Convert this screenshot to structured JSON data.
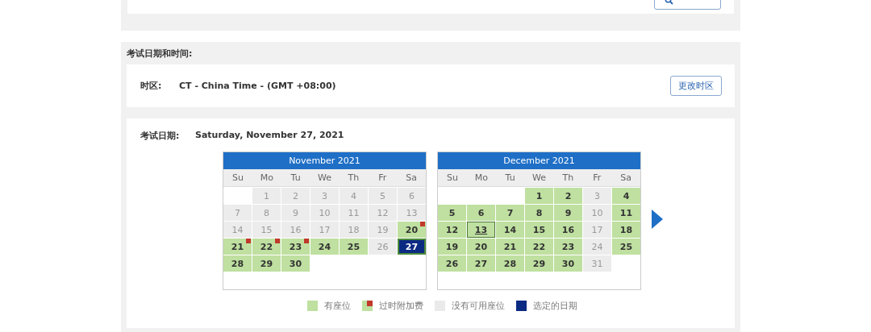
{
  "top_card": {
    "button": {
      "kind": "search"
    }
  },
  "section_title": "考试日期和时间:",
  "timezone": {
    "label": "时区:",
    "value": "CT - China Time - (GMT +08:00)",
    "button": "更改时区"
  },
  "exam_date": {
    "label": "考试日期:",
    "value": "Saturday, November 27, 2021"
  },
  "months": [
    {
      "title": "November 2021",
      "weekdays": [
        "Su",
        "Mo",
        "Tu",
        "We",
        "Th",
        "Fr",
        "Sa"
      ],
      "cells": [
        {
          "kind": "blank"
        },
        {
          "day": "1",
          "kind": "none",
          "selected": false,
          "outlined": false
        },
        {
          "day": "2",
          "kind": "none",
          "selected": false,
          "outlined": false
        },
        {
          "day": "3",
          "kind": "none",
          "selected": false,
          "outlined": false
        },
        {
          "day": "4",
          "kind": "none",
          "selected": false,
          "outlined": false
        },
        {
          "day": "5",
          "kind": "none",
          "selected": false,
          "outlined": false
        },
        {
          "day": "6",
          "kind": "none",
          "selected": false,
          "outlined": false
        },
        {
          "day": "7",
          "kind": "none",
          "selected": false,
          "outlined": false
        },
        {
          "day": "8",
          "kind": "none",
          "selected": false,
          "outlined": false
        },
        {
          "day": "9",
          "kind": "none",
          "selected": false,
          "outlined": false
        },
        {
          "day": "10",
          "kind": "none",
          "selected": false,
          "outlined": false
        },
        {
          "day": "11",
          "kind": "none",
          "selected": false,
          "outlined": false
        },
        {
          "day": "12",
          "kind": "none",
          "selected": false,
          "outlined": false
        },
        {
          "day": "13",
          "kind": "none",
          "selected": false,
          "outlined": false
        },
        {
          "day": "14",
          "kind": "none",
          "selected": false,
          "outlined": false
        },
        {
          "day": "15",
          "kind": "none",
          "selected": false,
          "outlined": false
        },
        {
          "day": "16",
          "kind": "none",
          "selected": false,
          "outlined": false
        },
        {
          "day": "17",
          "kind": "none",
          "selected": false,
          "outlined": false
        },
        {
          "day": "18",
          "kind": "none",
          "selected": false,
          "outlined": false
        },
        {
          "day": "19",
          "kind": "none",
          "selected": false,
          "outlined": false
        },
        {
          "day": "20",
          "kind": "late",
          "selected": false,
          "outlined": false
        },
        {
          "day": "21",
          "kind": "late",
          "selected": false,
          "outlined": false
        },
        {
          "day": "22",
          "kind": "late",
          "selected": false,
          "outlined": false
        },
        {
          "day": "23",
          "kind": "late",
          "selected": false,
          "outlined": false
        },
        {
          "day": "24",
          "kind": "seat",
          "selected": false,
          "outlined": false
        },
        {
          "day": "25",
          "kind": "seat",
          "selected": false,
          "outlined": false
        },
        {
          "day": "26",
          "kind": "none",
          "selected": false,
          "outlined": false
        },
        {
          "day": "27",
          "kind": "seat",
          "selected": true,
          "outlined": false
        },
        {
          "day": "28",
          "kind": "seat",
          "selected": false,
          "outlined": false
        },
        {
          "day": "29",
          "kind": "seat",
          "selected": false,
          "outlined": false
        },
        {
          "day": "30",
          "kind": "seat",
          "selected": false,
          "outlined": false
        },
        {
          "kind": "blank"
        },
        {
          "kind": "blank"
        },
        {
          "kind": "blank"
        },
        {
          "kind": "blank"
        },
        {
          "kind": "blank"
        },
        {
          "kind": "blank"
        },
        {
          "kind": "blank"
        },
        {
          "kind": "blank"
        },
        {
          "kind": "blank"
        },
        {
          "kind": "blank"
        },
        {
          "kind": "blank"
        }
      ]
    },
    {
      "title": "December 2021",
      "weekdays": [
        "Su",
        "Mo",
        "Tu",
        "We",
        "Th",
        "Fr",
        "Sa"
      ],
      "cells": [
        {
          "kind": "blank"
        },
        {
          "kind": "blank"
        },
        {
          "kind": "blank"
        },
        {
          "day": "1",
          "kind": "seat",
          "selected": false,
          "outlined": false
        },
        {
          "day": "2",
          "kind": "seat",
          "selected": false,
          "outlined": false
        },
        {
          "day": "3",
          "kind": "none",
          "selected": false,
          "outlined": false
        },
        {
          "day": "4",
          "kind": "seat",
          "selected": false,
          "outlined": false
        },
        {
          "day": "5",
          "kind": "seat",
          "selected": false,
          "outlined": false
        },
        {
          "day": "6",
          "kind": "seat",
          "selected": false,
          "outlined": false
        },
        {
          "day": "7",
          "kind": "seat",
          "selected": false,
          "outlined": false
        },
        {
          "day": "8",
          "kind": "seat",
          "selected": false,
          "outlined": false
        },
        {
          "day": "9",
          "kind": "seat",
          "selected": false,
          "outlined": false
        },
        {
          "day": "10",
          "kind": "none",
          "selected": false,
          "outlined": false
        },
        {
          "day": "11",
          "kind": "seat",
          "selected": false,
          "outlined": false
        },
        {
          "day": "12",
          "kind": "seat",
          "selected": false,
          "outlined": false
        },
        {
          "day": "13",
          "kind": "seat",
          "selected": false,
          "outlined": true
        },
        {
          "day": "14",
          "kind": "seat",
          "selected": false,
          "outlined": false
        },
        {
          "day": "15",
          "kind": "seat",
          "selected": false,
          "outlined": false
        },
        {
          "day": "16",
          "kind": "seat",
          "selected": false,
          "outlined": false
        },
        {
          "day": "17",
          "kind": "none",
          "selected": false,
          "outlined": false
        },
        {
          "day": "18",
          "kind": "seat",
          "selected": false,
          "outlined": false
        },
        {
          "day": "19",
          "kind": "seat",
          "selected": false,
          "outlined": false
        },
        {
          "day": "20",
          "kind": "seat",
          "selected": false,
          "outlined": false
        },
        {
          "day": "21",
          "kind": "seat",
          "selected": false,
          "outlined": false
        },
        {
          "day": "22",
          "kind": "seat",
          "selected": false,
          "outlined": false
        },
        {
          "day": "23",
          "kind": "seat",
          "selected": false,
          "outlined": false
        },
        {
          "day": "24",
          "kind": "none",
          "selected": false,
          "outlined": false
        },
        {
          "day": "25",
          "kind": "seat",
          "selected": false,
          "outlined": false
        },
        {
          "day": "26",
          "kind": "seat",
          "selected": false,
          "outlined": false
        },
        {
          "day": "27",
          "kind": "seat",
          "selected": false,
          "outlined": false
        },
        {
          "day": "28",
          "kind": "seat",
          "selected": false,
          "outlined": false
        },
        {
          "day": "29",
          "kind": "seat",
          "selected": false,
          "outlined": false
        },
        {
          "day": "30",
          "kind": "seat",
          "selected": false,
          "outlined": false
        },
        {
          "day": "31",
          "kind": "none",
          "selected": false,
          "outlined": false
        },
        {
          "kind": "blank"
        },
        {
          "kind": "blank"
        },
        {
          "kind": "blank"
        },
        {
          "kind": "blank"
        },
        {
          "kind": "blank"
        },
        {
          "kind": "blank"
        },
        {
          "kind": "blank"
        },
        {
          "kind": "blank"
        }
      ]
    }
  ],
  "legend": [
    {
      "kind": "seat",
      "label": "有座位"
    },
    {
      "kind": "late",
      "label": "过时附加费"
    },
    {
      "kind": "none",
      "label": "没有可用座位"
    },
    {
      "kind": "selected",
      "label": "选定的日期"
    }
  ]
}
